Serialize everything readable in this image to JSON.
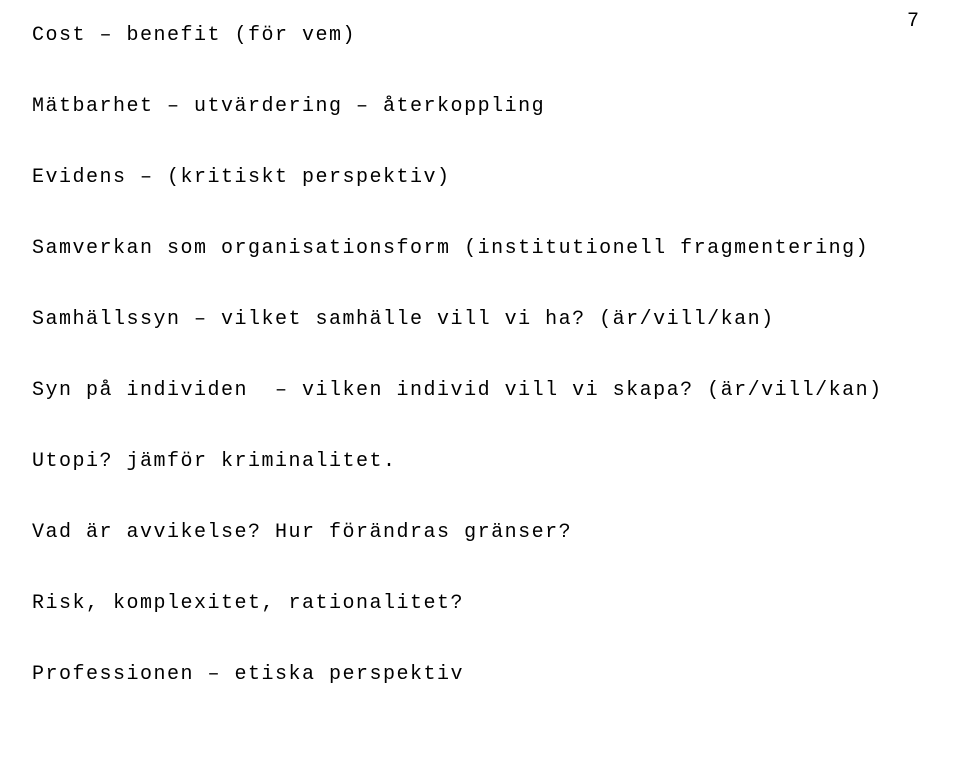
{
  "page_number": "7",
  "lines": [
    "Cost – benefit (för vem)",
    "Mätbarhet – utvärdering – återkoppling",
    "Evidens – (kritiskt perspektiv)",
    "Samverkan som organisationsform (institutionell fragmentering)",
    "Samhällssyn – vilket samhälle vill vi ha? (är/vill/kan)",
    "Syn på individen  – vilken individ vill vi skapa? (är/vill/kan)",
    "Utopi? jämför kriminalitet.",
    "Vad är avvikelse? Hur förändras gränser?",
    "Risk, komplexitet, rationalitet?",
    "Professionen – etiska perspektiv"
  ]
}
